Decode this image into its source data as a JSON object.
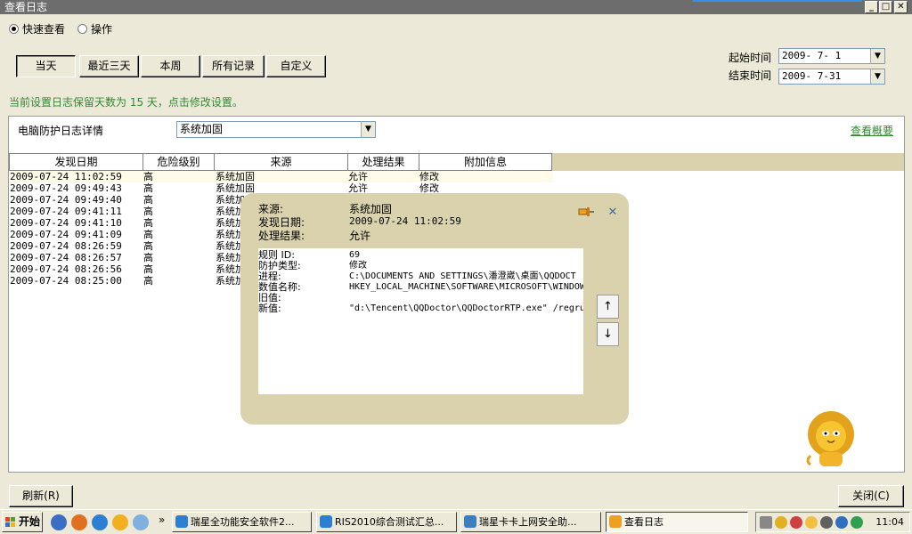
{
  "window": {
    "title": "查看日志",
    "minimize": "_",
    "maximize": "□",
    "close": "✕"
  },
  "view_mode": {
    "quick": "快速查看",
    "operate": "操作",
    "selected": "quick"
  },
  "filters": {
    "today": "当天",
    "last3": "最近三天",
    "week": "本周",
    "all": "所有记录",
    "custom": "自定义",
    "start_label": "起始时间",
    "start_value": "2009- 7- 1",
    "end_label": "结束时间",
    "end_value": "2009- 7-31"
  },
  "notice": "当前设置日志保留天数为 15 天，点击修改设置。",
  "panel": {
    "title": "电脑防护日志详情",
    "category": "系统加固",
    "summary_link": "查看概要"
  },
  "table": {
    "headers": [
      "发现日期",
      "危险级别",
      "来源",
      "处理结果",
      "附加信息"
    ],
    "rows": [
      [
        "2009-07-24 11:02:59",
        "高",
        "系统加固",
        "允许",
        "修改"
      ],
      [
        "2009-07-24 09:49:43",
        "高",
        "系统加固",
        "允许",
        "修改"
      ],
      [
        "2009-07-24 09:49:40",
        "高",
        "系统加",
        "",
        ""
      ],
      [
        "2009-07-24 09:41:11",
        "高",
        "系统加",
        "",
        ""
      ],
      [
        "2009-07-24 09:41:10",
        "高",
        "系统加",
        "",
        ""
      ],
      [
        "2009-07-24 09:41:09",
        "高",
        "系统加",
        "",
        ""
      ],
      [
        "2009-07-24 08:26:59",
        "高",
        "系统加",
        "",
        ""
      ],
      [
        "2009-07-24 08:26:57",
        "高",
        "系统加",
        "",
        ""
      ],
      [
        "2009-07-24 08:26:56",
        "高",
        "系统加",
        "",
        ""
      ],
      [
        "2009-07-24 08:25:00",
        "高",
        "系统加",
        "",
        ""
      ]
    ]
  },
  "detail": {
    "source_label": "来源:",
    "source_value": "系统加固",
    "date_label": "发现日期:",
    "date_value": "2009-07-24 11:02:59",
    "result_label": "处理结果:",
    "result_value": "允许",
    "fields": [
      {
        "label": "规则 ID:",
        "value": "69"
      },
      {
        "label": "防护类型:",
        "value": "修改"
      },
      {
        "label": "进程:",
        "value": "C:\\DOCUMENTS AND SETTINGS\\潘澄崴\\桌面\\QQDOCT"
      },
      {
        "label": "数值名称:",
        "value": "HKEY_LOCAL_MACHINE\\SOFTWARE\\MICROSOFT\\WINDOW"
      },
      {
        "label": "旧值:",
        "value": ""
      },
      {
        "label": "新值:",
        "value": "\"d:\\Tencent\\QQDoctor\\QQDoctorRTP.exe\" /regru"
      }
    ],
    "up": "↑",
    "down": "↓",
    "close": "✕"
  },
  "footer": {
    "refresh": "刷新(R)",
    "close": "关闭(C)"
  },
  "taskbar": {
    "start": "开始",
    "more": "»",
    "tasks": [
      "瑞星全功能安全软件2...",
      "RIS2010综合测试汇总...",
      "瑞星卡卡上网安全助...",
      "查看日志"
    ],
    "clock": "11:04"
  }
}
